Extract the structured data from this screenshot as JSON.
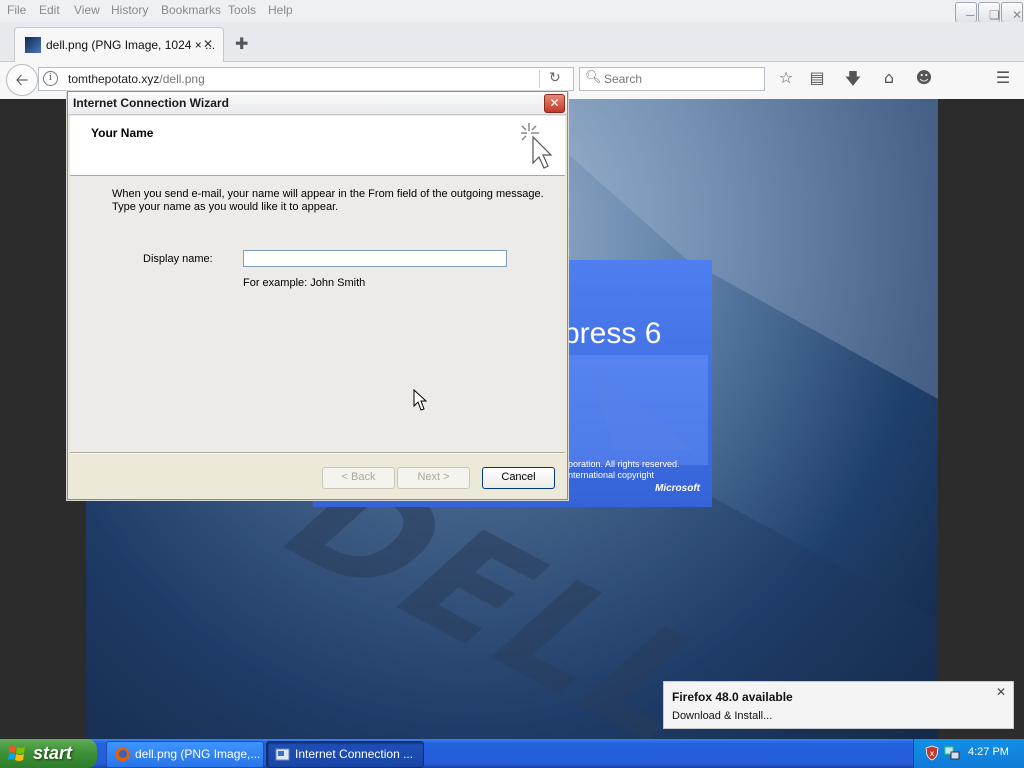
{
  "firefox": {
    "menu": [
      "File",
      "Edit",
      "View",
      "History",
      "Bookmarks",
      "Tools",
      "Help"
    ],
    "tab": {
      "title": "dell.png (PNG Image, 1024 × ..."
    },
    "url": {
      "domain": "tomthepotato.xyz",
      "path": "/dell.png"
    },
    "search": {
      "placeholder": "Search"
    },
    "notification": {
      "title": "Firefox 48.0 available",
      "link": "Download & Install..."
    }
  },
  "page": {
    "splash_title": "press 6",
    "splash_copy_1": "poration. All rights reserved.",
    "splash_copy_2": "nternational copyright",
    "splash_brand": "Microsoft"
  },
  "wizard": {
    "title": "Internet Connection Wizard",
    "heading": "Your Name",
    "instruction_1": "When you send e-mail, your name will appear in the From field of the outgoing message.",
    "instruction_2": "Type your name as you would like it to appear.",
    "display_name_label": "Display name:",
    "display_name_value": "",
    "example": "For example: John Smith",
    "buttons": {
      "back": "< Back",
      "next": "Next >",
      "cancel": "Cancel"
    }
  },
  "taskbar": {
    "start": "start",
    "items": [
      {
        "label": "dell.png (PNG Image,..."
      },
      {
        "label": "Internet Connection ..."
      }
    ],
    "clock": "4:27 PM"
  }
}
